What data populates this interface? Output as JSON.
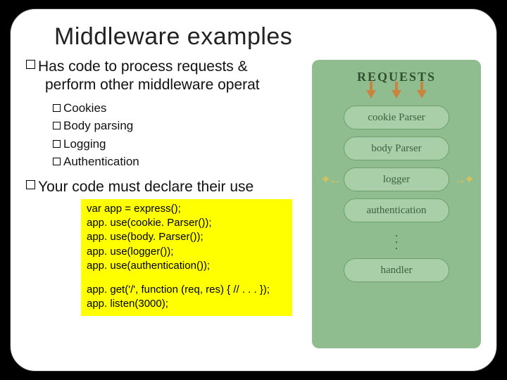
{
  "title": "Middleware examples",
  "bullets": {
    "b1_line1": "Has code to process requests &",
    "b1_line2": "perform other middleware operat",
    "b2": "Your code must declare their use"
  },
  "sub": {
    "s0": "Cookies",
    "s1": "Body parsing",
    "s2": "Logging",
    "s3": "Authentication"
  },
  "code": {
    "l0": "var app = express();",
    "l1": "app. use(cookie. Parser());",
    "l2": "app. use(body. Parser());",
    "l3": "app. use(logger());",
    "l4": "app. use(authentication());",
    "l5": "app. get('/', function (req, res) { // . . . });",
    "l6": "app. listen(3000);"
  },
  "diagram": {
    "requests": "REQUESTS",
    "m0": "cookie Parser",
    "m1": "body Parser",
    "m2": "logger",
    "m3": "authentication",
    "m4": "handler"
  }
}
